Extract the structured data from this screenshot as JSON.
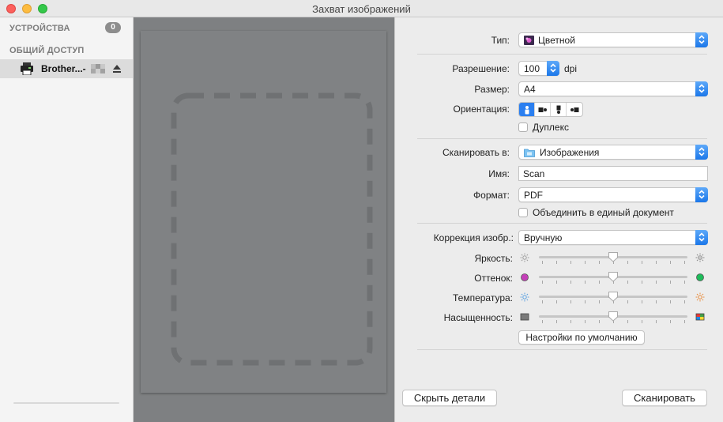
{
  "window": {
    "title": "Захват изображений"
  },
  "sidebar": {
    "devices_header": "УСТРОЙСТВА",
    "devices_count": "0",
    "shared_header": "ОБЩИЙ ДОСТУП",
    "shared_items": [
      {
        "label": "Brother...-",
        "icon": "printer-icon",
        "selected": true
      }
    ]
  },
  "settings": {
    "type": {
      "label": "Тип:",
      "value": "Цветной",
      "icon": "color-photo-icon"
    },
    "resolution": {
      "label": "Разрешение:",
      "value": "100",
      "unit": "dpi"
    },
    "size": {
      "label": "Размер:",
      "value": "A4"
    },
    "orientation": {
      "label": "Ориентация:",
      "selected_index": 0
    },
    "duplex": {
      "label": "Дуплекс",
      "checked": false
    },
    "scan_to": {
      "label": "Сканировать в:",
      "value": "Изображения",
      "icon": "folder-icon"
    },
    "name": {
      "label": "Имя:",
      "value": "Scan"
    },
    "format": {
      "label": "Формат:",
      "value": "PDF"
    },
    "combine": {
      "label": "Объединить в единый документ",
      "checked": false
    },
    "correction": {
      "label": "Коррекция изобр.:",
      "value": "Вручную"
    },
    "sliders": [
      {
        "label": "Яркость:",
        "value": 0.5,
        "left_icon": "sun-dim-icon",
        "right_icon": "sun-bright-icon"
      },
      {
        "label": "Оттенок:",
        "value": 0.5,
        "left_icon": "magenta-dot-icon",
        "right_icon": "green-dot-icon"
      },
      {
        "label": "Температура:",
        "value": 0.5,
        "left_icon": "cold-sun-icon",
        "right_icon": "warm-sun-icon"
      },
      {
        "label": "Насыщенность:",
        "value": 0.5,
        "left_icon": "grayscale-icon",
        "right_icon": "color-square-icon"
      }
    ],
    "defaults_button": "Настройки по умолчанию"
  },
  "footer": {
    "hide_details_button": "Скрыть детали",
    "scan_button": "Сканировать"
  },
  "colors": {
    "accent": "#2b7ff0",
    "preview_bg": "#7e8082"
  }
}
